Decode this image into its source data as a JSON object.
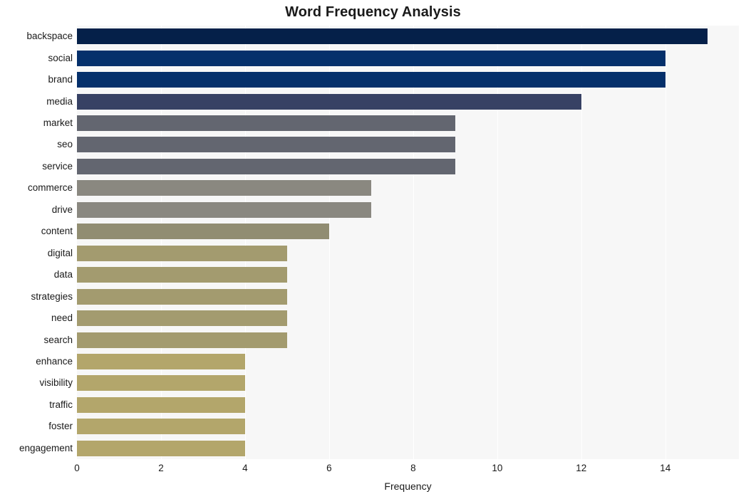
{
  "chart_data": {
    "type": "bar",
    "orientation": "horizontal",
    "title": "Word Frequency Analysis",
    "xlabel": "Frequency",
    "ylabel": "",
    "xlim": [
      0,
      15.75
    ],
    "xticks": [
      0,
      2,
      4,
      6,
      8,
      10,
      12,
      14
    ],
    "xtick_labels": [
      "0",
      "2",
      "4",
      "6",
      "8",
      "10",
      "12",
      "14"
    ],
    "grid": "vertical",
    "legend": "none",
    "plot_background": "#f7f7f7",
    "gridline_color": "#ffffff",
    "categories": [
      "backspace",
      "social",
      "brand",
      "media",
      "market",
      "seo",
      "service",
      "commerce",
      "drive",
      "content",
      "digital",
      "data",
      "strategies",
      "need",
      "search",
      "enhance",
      "visibility",
      "traffic",
      "foster",
      "engagement"
    ],
    "values": [
      15,
      14,
      14,
      12,
      9,
      9,
      9,
      7,
      7,
      6,
      5,
      5,
      5,
      5,
      5,
      4,
      4,
      4,
      4,
      4
    ],
    "bar_colors": [
      "#052049",
      "#05306b",
      "#05306b",
      "#374164",
      "#636670",
      "#636670",
      "#636670",
      "#8a8880",
      "#8a8880",
      "#918d72",
      "#a39b6f",
      "#a39b6f",
      "#a39b6f",
      "#a39b6f",
      "#a39b6f",
      "#b3a66b",
      "#b3a66b",
      "#b3a66b",
      "#b3a66b",
      "#b3a66b"
    ]
  }
}
